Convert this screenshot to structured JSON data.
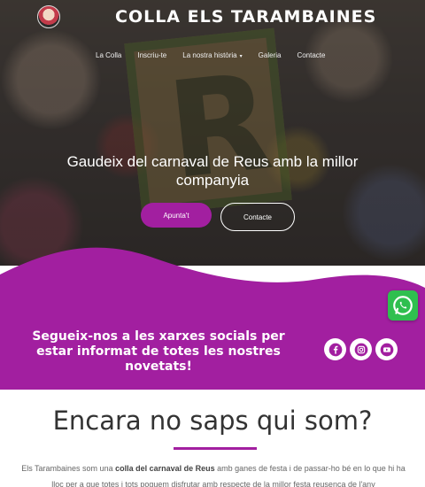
{
  "header": {
    "title": "COLLA ELS TARAMBAINES",
    "nav": [
      {
        "label": "La Colla"
      },
      {
        "label": "Inscriu-te"
      },
      {
        "label": "La nostra història",
        "has_dropdown": true
      },
      {
        "label": "Galeria"
      },
      {
        "label": "Contacte"
      }
    ]
  },
  "hero": {
    "headline": "Gaudeix del carnaval de Reus amb la millor companyia",
    "primary_button": "Apunta't",
    "secondary_button": "Contacte",
    "sign_letter": "R"
  },
  "social": {
    "text": "Segueix-nos a les xarxes socials per estar informat de totes les nostres novetats!",
    "icons": [
      "facebook-icon",
      "instagram-icon",
      "youtube-icon"
    ],
    "floating": "whatsapp-icon"
  },
  "about": {
    "title": "Encara no saps qui som?",
    "text_start": "Els Tarambaines som una ",
    "text_bold": "colla del carnaval de Reus",
    "text_end": " amb ganes de festa i de passar-ho bé en lo que hi ha",
    "text_line2": "lloc per a que totes i tots poguem disfrutar amb respecte de la millor festa reusenca de l'any"
  },
  "colors": {
    "accent": "#a21fa0",
    "whatsapp": "#2fbf4f"
  }
}
